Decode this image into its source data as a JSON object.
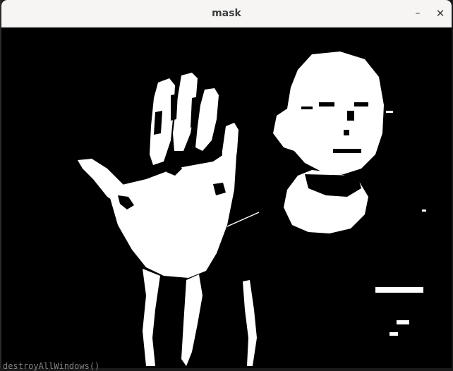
{
  "window": {
    "title": "mask",
    "minimize_glyph": "–",
    "close_glyph": "✕"
  },
  "background_terminal": {
    "partial_line": "destroyAllWindows()"
  },
  "image": {
    "type": "binary-mask",
    "foreground_color": "#ffffff",
    "background_color": "#000000",
    "subjects": [
      "raised-hand",
      "face",
      "neck"
    ]
  }
}
